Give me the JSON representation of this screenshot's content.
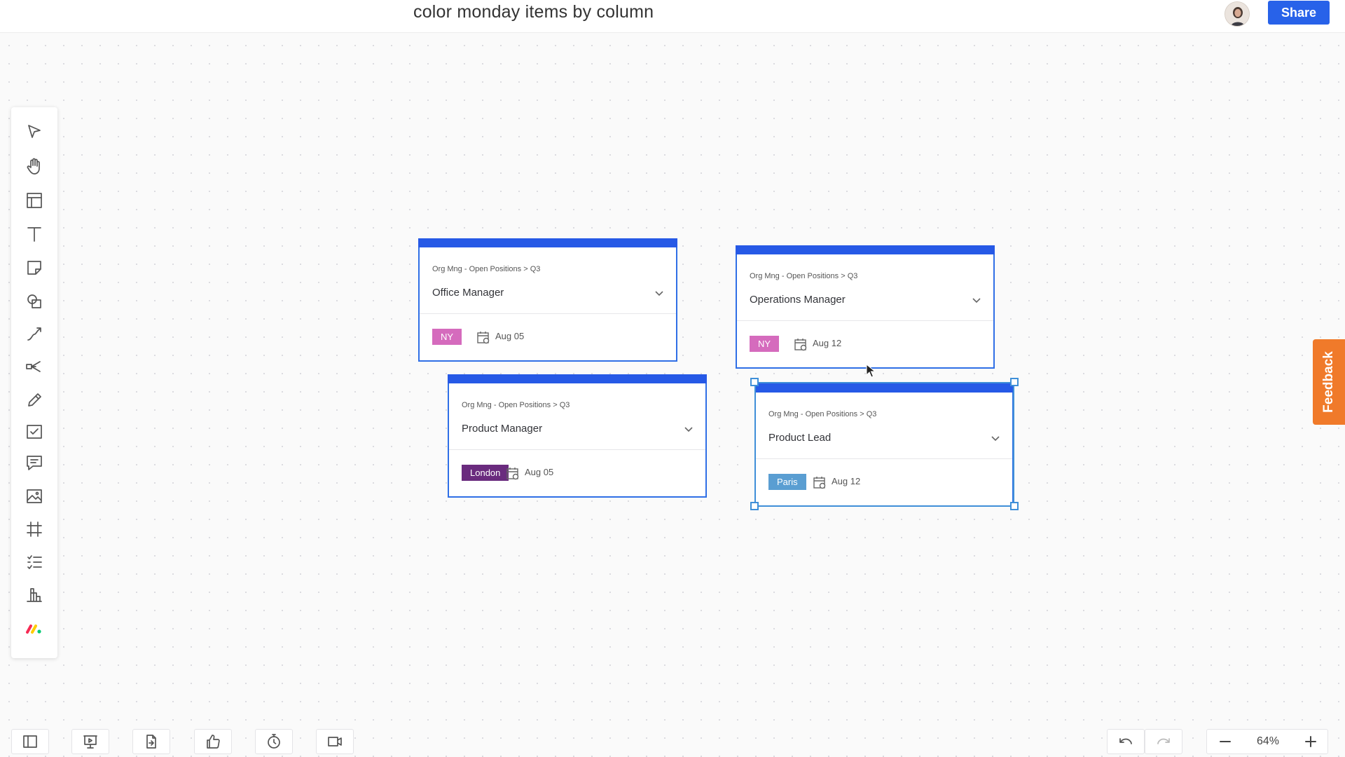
{
  "header": {
    "board_title": "color monday items by column",
    "share_label": "Share"
  },
  "colors": {
    "accent": "#2659e6",
    "share_button": "#2862e9",
    "tag_ny": "#d56bbd",
    "tag_london": "#6a2b7e",
    "tag_paris": "#5a9ed2",
    "feedback": "#f07a2a",
    "selection": "#3f8fd8"
  },
  "toolbar": {
    "tools": [
      "select-icon",
      "hand-icon",
      "layout-icon",
      "text-icon",
      "sticky-note-icon",
      "shapes-icon",
      "connector-icon",
      "mind-map-icon",
      "pen-icon",
      "checklist-icon",
      "comment-icon",
      "image-icon",
      "frame-icon",
      "list-icon",
      "chart-icon",
      "monday-logo-icon"
    ]
  },
  "cards": [
    {
      "breadcrumb": "Org Mng - Open Positions > Q3",
      "name": "Office Manager",
      "tag": "NY",
      "date": "Aug 05"
    },
    {
      "breadcrumb": "Org Mng - Open Positions > Q3",
      "name": "Operations Manager",
      "tag": "NY",
      "date": "Aug 12"
    },
    {
      "breadcrumb": "Org Mng - Open Positions > Q3",
      "name": "Product Manager",
      "tag": "London",
      "date": "Aug 05"
    },
    {
      "breadcrumb": "Org Mng - Open Positions > Q3",
      "name": "Product Lead",
      "tag": "Paris",
      "date": "Aug 12"
    }
  ],
  "feedback_label": "Feedback",
  "bottom_bar": {
    "buttons": [
      "sidebar-icon",
      "presentation-icon",
      "export-icon",
      "thumbs-up-icon",
      "timer-icon",
      "video-icon"
    ],
    "zoom_level": "64%"
  }
}
